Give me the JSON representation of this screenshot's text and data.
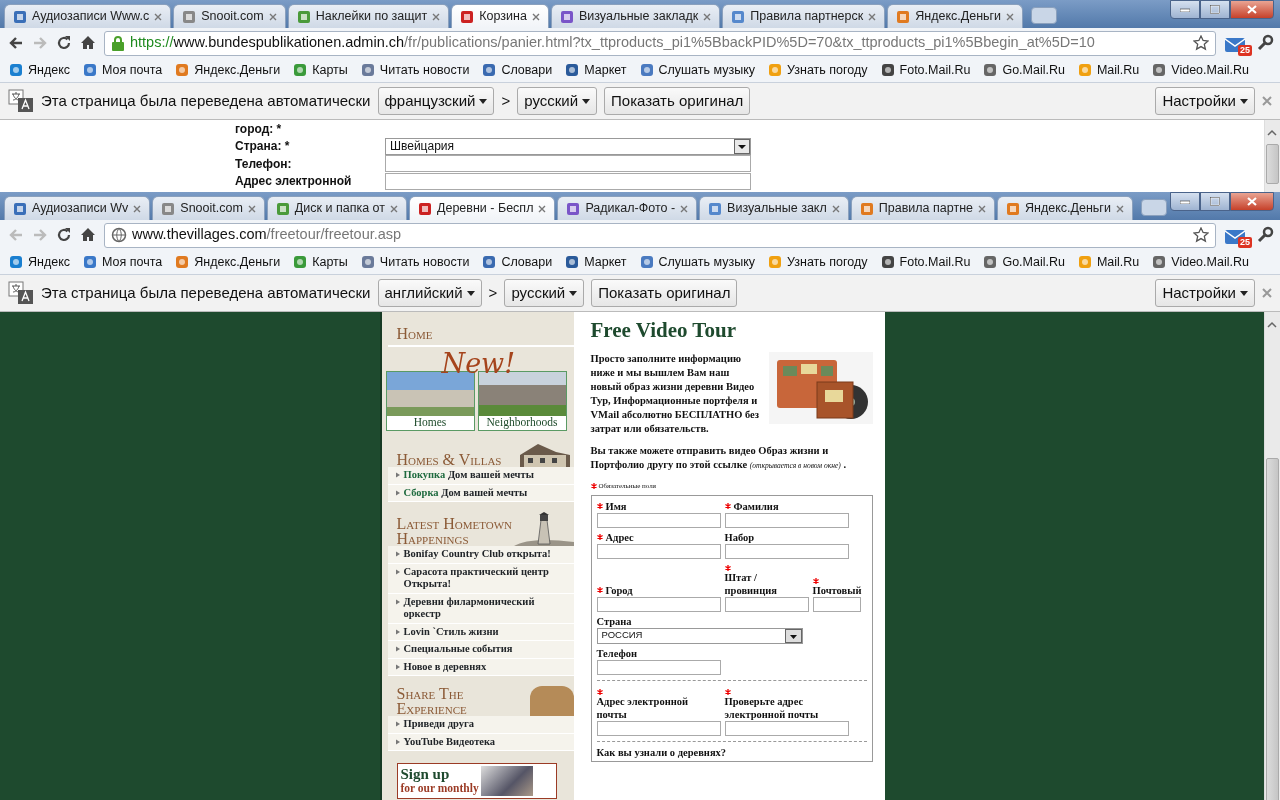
{
  "windows": [
    {
      "tabs": [
        {
          "title": "Аудиозаписи Www.с",
          "selected": false
        },
        {
          "title": "Snooit.com",
          "selected": false
        },
        {
          "title": "Наклейки по защит",
          "selected": false
        },
        {
          "title": "Корзина",
          "selected": true
        },
        {
          "title": "Визуальные закладк",
          "selected": false
        },
        {
          "title": "Правила партнерск",
          "selected": false
        },
        {
          "title": "Яндекс.Деньги",
          "selected": false
        }
      ],
      "nav": {
        "back": {
          "disabled": false
        },
        "forward": {
          "disabled": true
        }
      },
      "address": {
        "secure": true,
        "scheme": "https://",
        "host": "www.bundespublikationen.admin.ch",
        "path": "/fr/publications/panier.html?tx_ttproducts_pi1%5BbackPID%5D=70&tx_ttproducts_pi1%5Bbegin_at%5D=10"
      },
      "mail_badge": "25",
      "bookmarks": [
        "Яндекс",
        "Моя почта",
        "Яндекс.Деньги",
        "Карты",
        "Читать новости",
        "Словари",
        "Маркет",
        "Слушать музыку",
        "Узнать погоду",
        "Foto.Mail.Ru",
        "Go.Mail.Ru",
        "Mail.Ru",
        "Video.Mail.Ru"
      ],
      "translate": {
        "message": "Эта страница была переведена автоматически",
        "from": "французский",
        "separator": ">",
        "to": "русский",
        "show_original": "Показать оригинал",
        "settings": "Настройки"
      },
      "page": {
        "kind": "order_form",
        "rows": [
          {
            "label": "город: *",
            "kind": "none"
          },
          {
            "label": "Страна: *",
            "kind": "select",
            "value": "Швейцария"
          },
          {
            "label": "Телефон:",
            "kind": "text"
          },
          {
            "label": "Адрес электронной",
            "kind": "text"
          }
        ]
      }
    },
    {
      "tabs": [
        {
          "title": "Аудиозаписи Wv",
          "selected": false
        },
        {
          "title": "Snooit.com",
          "selected": false
        },
        {
          "title": "Диск и папка от",
          "selected": false
        },
        {
          "title": "Деревни - Беспл",
          "selected": true
        },
        {
          "title": "Радикал-Фото - ",
          "selected": false
        },
        {
          "title": "Визуальные закл",
          "selected": false
        },
        {
          "title": "Правила партне",
          "selected": false
        },
        {
          "title": "Яндекс.Деньги",
          "selected": false
        }
      ],
      "nav": {
        "back": {
          "disabled": true
        },
        "forward": {
          "disabled": true
        }
      },
      "address": {
        "secure": false,
        "host": "www.thevillages.com",
        "path": "/freetour/freetour.asp"
      },
      "mail_badge": "25",
      "bookmarks": [
        "Яндекс",
        "Моя почта",
        "Яндекс.Деньги",
        "Карты",
        "Читать новости",
        "Словари",
        "Маркет",
        "Слушать музыку",
        "Узнать погоду",
        "Foto.Mail.Ru",
        "Go.Mail.Ru",
        "Mail.Ru",
        "Video.Mail.Ru"
      ],
      "translate": {
        "message": "Эта страница была переведена автоматически",
        "from": "английский",
        "separator": ">",
        "to": "русский",
        "show_original": "Показать оригинал",
        "settings": "Настройки"
      },
      "page": {
        "kind": "village_tour",
        "sidebar": {
          "home": "Home",
          "new_label": "New!",
          "tiles": [
            "Homes",
            "Neighborhoods"
          ],
          "sections": [
            {
              "title": "Homes & Villas",
              "kind": "house",
              "links": [
                "**Покупка** Дом вашей мечты",
                "**Сборка** Дом вашей мечты"
              ]
            },
            {
              "title": "Latest Hometown Happenings",
              "kind": "lighthouse",
              "links": [
                "Bonifay Country Club открыта!",
                "Сарасота практический центр Открыта!",
                "Деревни филармонический оркестр",
                "Lovin `Стиль жизни",
                "Специальные события",
                "Новое в деревнях"
              ]
            },
            {
              "title": "Share The Experience",
              "kind": "sculpture",
              "links": [
                "Приведи друга",
                "YouTube Видеотека"
              ]
            }
          ],
          "signup": [
            "Sign up",
            "for our monthly"
          ]
        },
        "main": {
          "title": "Free Video Tour",
          "intro": "Просто заполните информацию ниже и мы вышлем Вам наш новый образ жизни деревни Видео Тур, Информационные портфеля и VMail абсолютно БЕСПЛАТНО без затрат или обязательств.",
          "share": {
            "before": "Вы также можете отправить видео Образ жизни и Портфолио другу по ",
            "link": "этой ссылке",
            "after": " *(открывается в новом окне)* ."
          },
          "required_note": "Обязательные поля",
          "groups": [
            [
              [
                {
                  "label": "Имя",
                  "required": true,
                  "kind": "text"
                },
                {
                  "label": "Фамилия",
                  "required": true,
                  "kind": "text"
                }
              ],
              [
                {
                  "label": "Адрес",
                  "required": true,
                  "kind": "text"
                },
                {
                  "label": "Набор",
                  "required": false,
                  "kind": "text"
                }
              ],
              [
                {
                  "label": "Город",
                  "required": true,
                  "kind": "text"
                },
                {
                  "label": "Штат / провинция",
                  "required": true,
                  "kind": "text"
                },
                {
                  "label": "Почтовый",
                  "required": true,
                  "kind": "text"
                }
              ],
              [
                {
                  "label": "Страна",
                  "required": false,
                  "kind": "select",
                  "value": "РОССИЯ"
                }
              ],
              [
                {
                  "label": "Телефон",
                  "required": false,
                  "kind": "text"
                }
              ]
            ],
            [
              [
                {
                  "label": "Адрес электронной почты",
                  "required": true,
                  "kind": "text"
                },
                {
                  "label": "Проверьте адрес электронной почты",
                  "required": true,
                  "kind": "text"
                }
              ]
            ]
          ],
          "question": "Как вы узнали о деревнях?"
        }
      }
    }
  ]
}
